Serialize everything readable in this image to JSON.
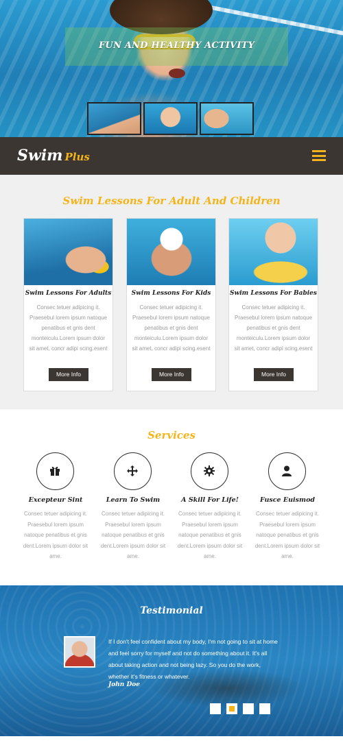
{
  "hero": {
    "title": "FUN AND HEALTHY ACTIVITY",
    "thumbnails": [
      "swimmer-thumbnail",
      "goggles-kid-thumbnail",
      "resting-kid-thumbnail"
    ]
  },
  "header": {
    "logo_main": "Swim",
    "logo_accent": "Plus",
    "menu_icon": "hamburger-menu-icon"
  },
  "lessons": {
    "title": "Swim Lessons For Adult And Children",
    "cards": [
      {
        "title": "Swim Lessons For Adults",
        "text": "Consec tetuer adipicing it. Praesebul lorem ipsum natoque penatibus et gnis dent monteiculu.Lorem ipsum dolor sit amet, concr adipi scing.esent",
        "button": "More Info"
      },
      {
        "title": "Swim Lessons For Kids",
        "text": "Consec tetuer adipicing it. Praesebul lorem ipsum natoque penatibus et gnis dent monteiculu.Lorem ipsum dolor sit amet, concr adipi scing.esent",
        "button": "More Info"
      },
      {
        "title": "Swim Lessons For Babies",
        "text": "Consec tetuer adipicing it. Praesebul lorem ipsum natoque penatibus et gnis dent monteiculu.Lorem ipsum dolor sit amet, concr adipi scing.esent",
        "button": "More Info"
      }
    ]
  },
  "services": {
    "title": "Services",
    "items": [
      {
        "icon": "gift-icon",
        "title": "Excepteur Sint",
        "text": "Consec tetuer adipicing it. Praesebul lorem ipsum natoque penatibus et gnis dent.Lorem ipsum dolor sit ame."
      },
      {
        "icon": "move-arrows-icon",
        "title": "Learn To Swim",
        "text": "Consec tetuer adipicing it. Praesebul lorem ipsum natoque penatibus et gnis dent.Lorem ipsum dolor sit ame."
      },
      {
        "icon": "gear-icon",
        "title": "A Skill For Life!",
        "text": "Consec tetuer adipicing it. Praesebul lorem ipsum natoque penatibus et gnis dent.Lorem ipsum dolor sit ame."
      },
      {
        "icon": "user-icon",
        "title": "Fusce Euismod",
        "text": "Consec tetuer adipicing it. Praesebul lorem ipsum natoque penatibus et gnis dent.Lorem ipsum dolor sit ame."
      }
    ]
  },
  "testimonial": {
    "title": "Testimonial",
    "quote": "If I don't feel confident about my body, I'm not going to sit at home and feel sorry for myself and not do something about it. It's all about taking action and not being lazy. So you do the work, whether it's fitness or whatever.",
    "author": "John Doe",
    "pager_active": 2,
    "pager_count": 4
  },
  "colors": {
    "accent": "#f4b41a",
    "dark": "#3b3632",
    "section_bg": "#f0f0f0"
  }
}
